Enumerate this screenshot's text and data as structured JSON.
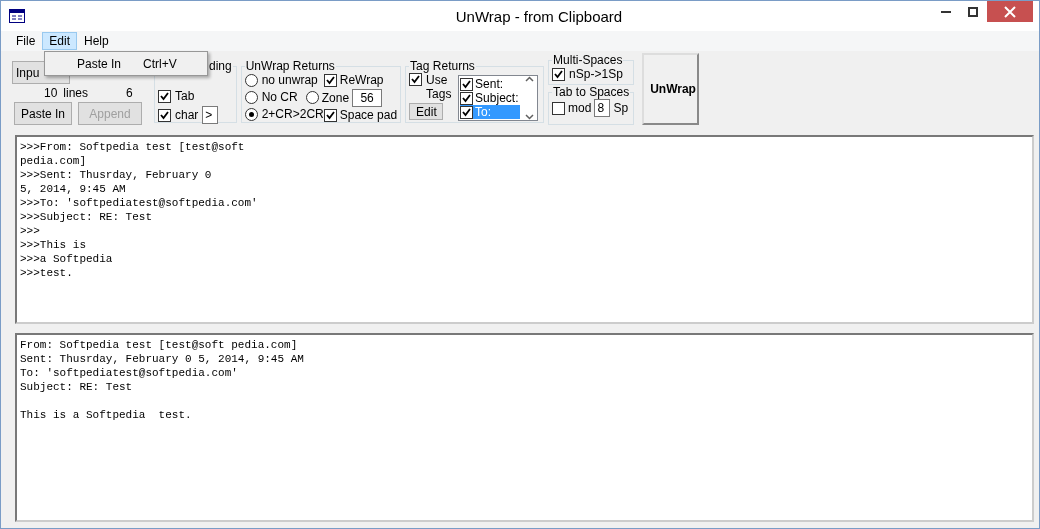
{
  "window": {
    "title": "UnWrap - from Clipboard"
  },
  "menu": [
    {
      "label": "File",
      "selected": false
    },
    {
      "label": "Edit",
      "selected": true
    },
    {
      "label": "Help",
      "selected": false
    }
  ],
  "open_menu": {
    "items": [
      {
        "label": "Paste In",
        "shortcut": "Ctrl+V"
      }
    ]
  },
  "input_panel": {
    "input_button": "Inpu",
    "lines_count": "10",
    "lines_label": "lines",
    "count": "6",
    "paste_button": "Paste In",
    "append_button": {
      "label": "Append",
      "disabled": true
    }
  },
  "leading": {
    "title": "ding",
    "tab": {
      "label": "Tab",
      "checked": true
    },
    "char": {
      "label": "char",
      "checked": true,
      "value": ">"
    }
  },
  "unwrap_returns": {
    "title": "UnWrap Returns",
    "radios": [
      {
        "label": "no unwrap",
        "selected": false
      },
      {
        "label": "No CR",
        "selected": false
      },
      {
        "label": "2+CR>2CR",
        "selected": true
      }
    ],
    "rewrap": {
      "label": "ReWrap",
      "checked": true
    },
    "zone": {
      "label": "Zone",
      "selected": false,
      "value": "56"
    },
    "space_pad": {
      "label": "Space pad",
      "checked": true
    }
  },
  "tag_returns": {
    "title": "Tag Returns",
    "use_tags": {
      "label": "Use Tags",
      "checked": true
    },
    "edit_button": "Edit",
    "tags": [
      {
        "label": "Sent:",
        "checked": true,
        "selected": false
      },
      {
        "label": "Subject:",
        "checked": true,
        "selected": false
      },
      {
        "label": "To:",
        "checked": true,
        "selected": true
      }
    ]
  },
  "multi_spaces": {
    "title": "Multi-Spaces",
    "option": {
      "label": "nSp->1Sp",
      "checked": true
    }
  },
  "tab_to_spaces": {
    "title": "Tab to Spaces",
    "mod": {
      "label": "mod",
      "checked": false
    },
    "value": "8",
    "unit": "Sp"
  },
  "unwrap_button": "UnWrap",
  "input_text": [
    ">>>From: Softpedia test [test@soft",
    "pedia.com]",
    ">>>Sent: Thusrday, February 0",
    "5, 2014, 9:45 AM",
    ">>>To: 'softpediatest@softpedia.com'",
    ">>>Subject: RE: Test",
    ">>>",
    ">>>This is",
    ">>>a Softpedia",
    ">>>test."
  ],
  "output_text": [
    [
      "From: Softpedia test [test@soft pedia.com]",
      "Sent: Thusrday, February 0 5, 2014, 9:45 AM",
      "To: 'softpediatest@softpedia.com'",
      "Subject: RE: Test"
    ],
    [
      "This is a Softpedia  test."
    ]
  ]
}
